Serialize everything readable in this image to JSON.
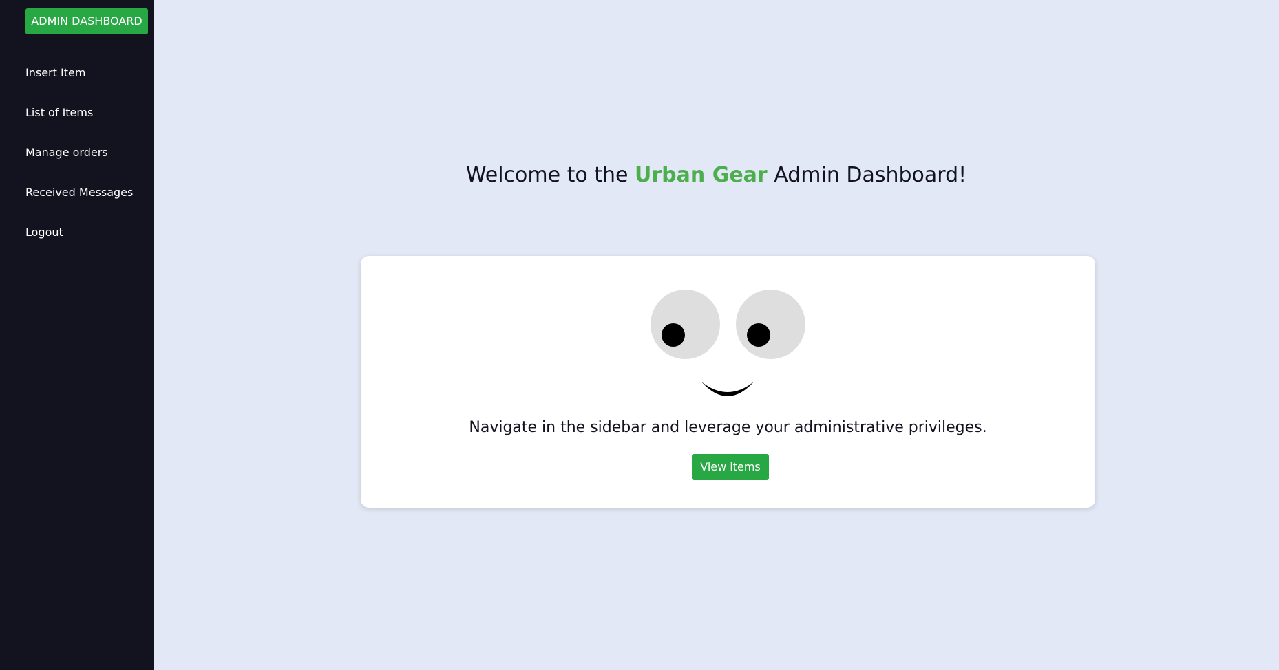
{
  "sidebar": {
    "brand_label": "ADMIN DASHBOARD",
    "items": [
      {
        "label": "Insert Item"
      },
      {
        "label": "List of Items"
      },
      {
        "label": "Manage orders"
      },
      {
        "label": "Received Messages"
      },
      {
        "label": "Logout"
      }
    ]
  },
  "main": {
    "welcome": {
      "prefix": "Welcome to the ",
      "brand": "Urban Gear",
      "suffix": " Admin Dashboard!"
    },
    "card": {
      "message": "Navigate in the sidebar and leverage your administrative privileges.",
      "button_label": "View items"
    }
  },
  "colors": {
    "accent": "#28a745",
    "brand_text": "#4cae4c",
    "sidebar_bg": "#131320",
    "page_bg": "#e2e8f5",
    "card_bg": "#ffffff"
  }
}
